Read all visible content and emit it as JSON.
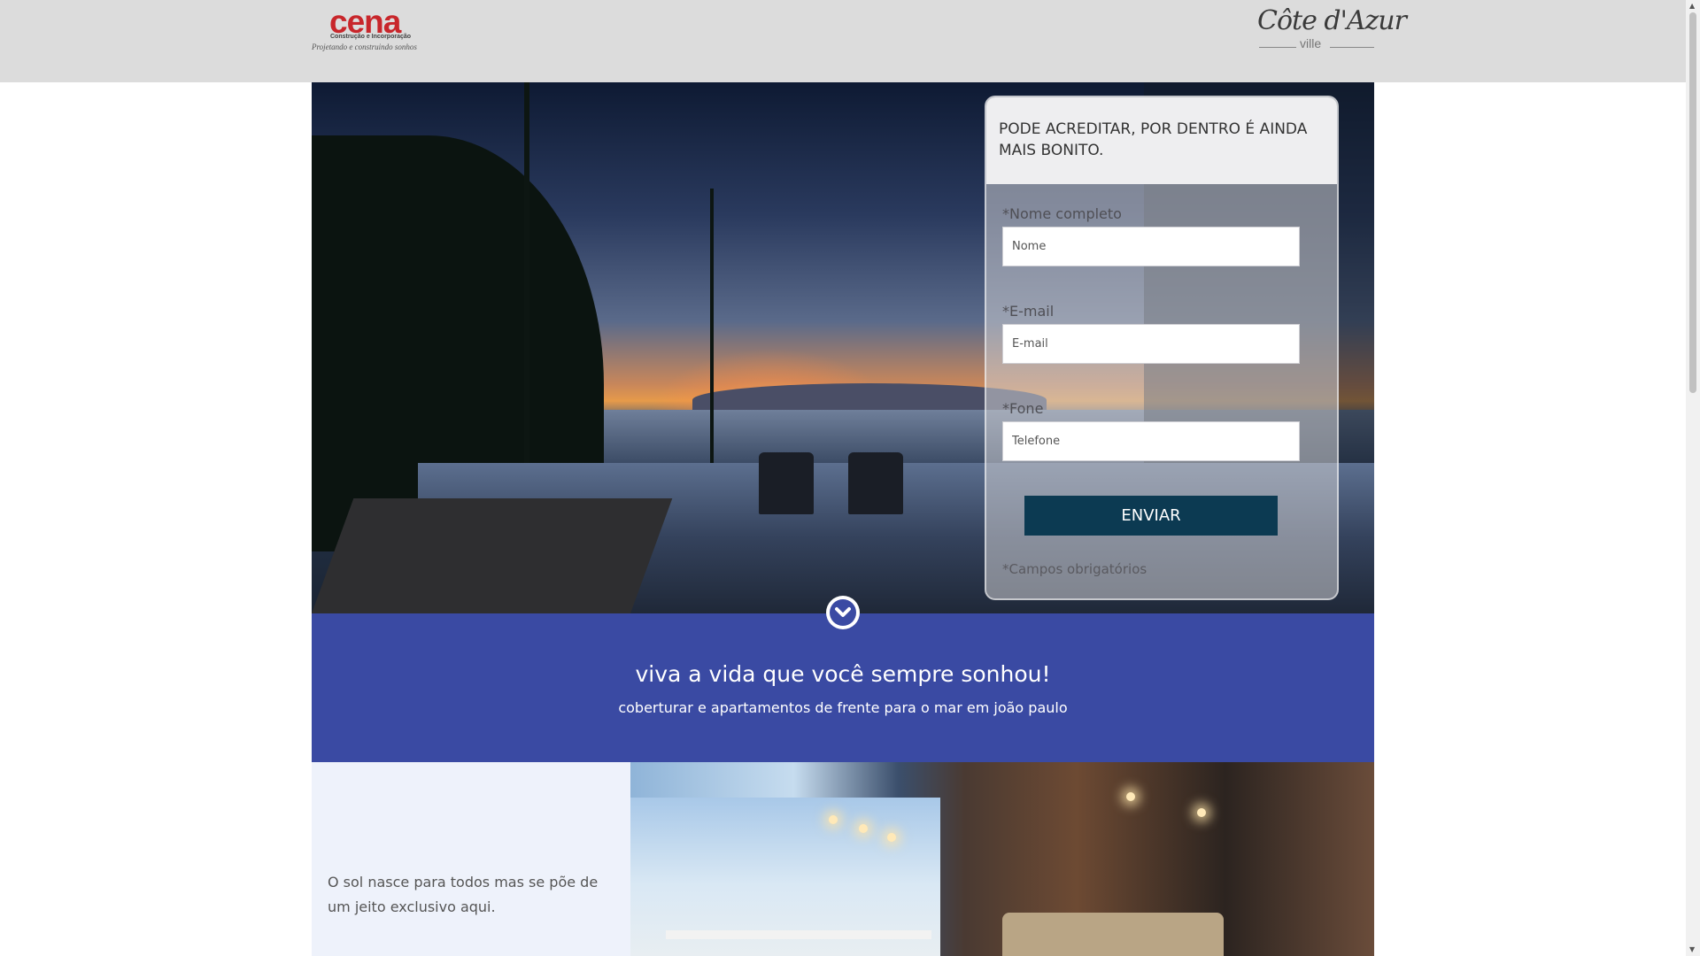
{
  "header": {
    "left_logo": {
      "brand": "cena",
      "subtitle": "Construção e Incorporação",
      "tagline": "Projetando e construindo sonhos",
      "brand_color": "#c8262b"
    },
    "right_logo": {
      "script": "Côte d'Azur",
      "sub": "ville"
    }
  },
  "form": {
    "heading": "PODE ACREDITAR, POR DENTRO É AINDA MAIS BONITO.",
    "fields": [
      {
        "label": "*Nome completo",
        "placeholder": "Nome"
      },
      {
        "label": "*E-mail",
        "placeholder": "E-mail"
      },
      {
        "label": "*Fone",
        "placeholder": "Telefone"
      }
    ],
    "submit_label": "ENVIAR",
    "required_note": "*Campos obrigatórios",
    "button_color": "#0c3a52"
  },
  "scroll_icon": "chevron-down-icon",
  "band": {
    "headline": "viva a vida que você sempre sonhou!",
    "subline": "coberturar e apartamentos de frente para o mar em joão paulo",
    "background": "#3a4aa3"
  },
  "feature": {
    "text": "O sol nasce para todos mas se põe de um jeito exclusivo aqui."
  }
}
